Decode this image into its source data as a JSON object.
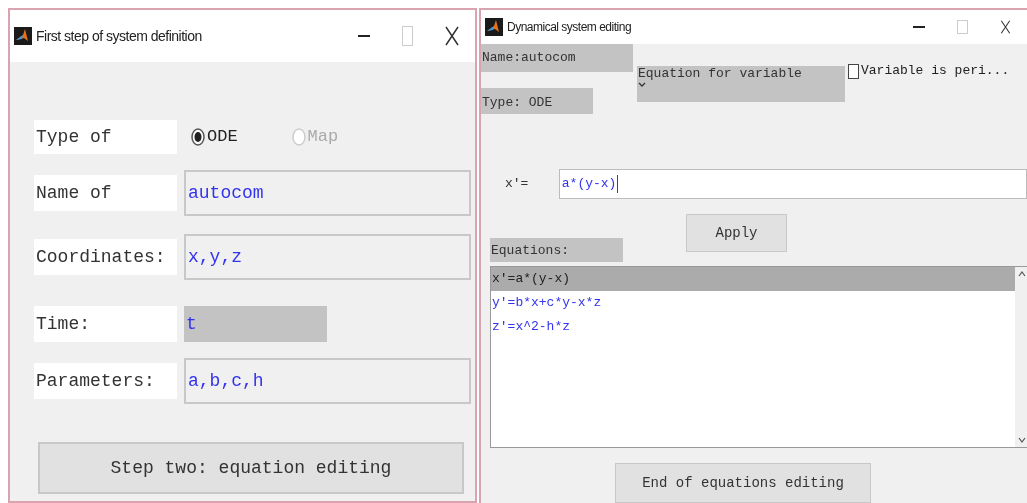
{
  "left_window": {
    "title": "First step of system definition",
    "type_row": {
      "label": "Type of",
      "options": [
        {
          "label": "ODE",
          "selected": true
        },
        {
          "label": "Map",
          "selected": false
        }
      ]
    },
    "fields": [
      {
        "label": "Name of",
        "value": "autocom",
        "disabled": false
      },
      {
        "label": "Coordinates:",
        "value": "x,y,z",
        "disabled": false
      },
      {
        "label": "Time:",
        "value": "t",
        "disabled": true
      },
      {
        "label": "Parameters:",
        "value": "a,b,c,h",
        "disabled": false
      }
    ],
    "button": "Step two: equation editing"
  },
  "right_window": {
    "title": "Dynamical system editing",
    "name_label": "Name:autocom",
    "type_label": "Type: ODE",
    "variable_dropdown": "Equation for variable",
    "periodic_checkbox": {
      "label": "Variable is peri...",
      "checked": false
    },
    "equation": {
      "label": "x'=",
      "value": "a*(y-x)"
    },
    "apply_button": "Apply",
    "equations_label": "Equations:",
    "equations": [
      {
        "text": "x'=a*(y-x)",
        "selected": true
      },
      {
        "text": "y'=b*x+c*y-x*z",
        "selected": false
      },
      {
        "text": "z'=x^2-h*z",
        "selected": false
      }
    ],
    "end_button": "End of equations editing"
  }
}
